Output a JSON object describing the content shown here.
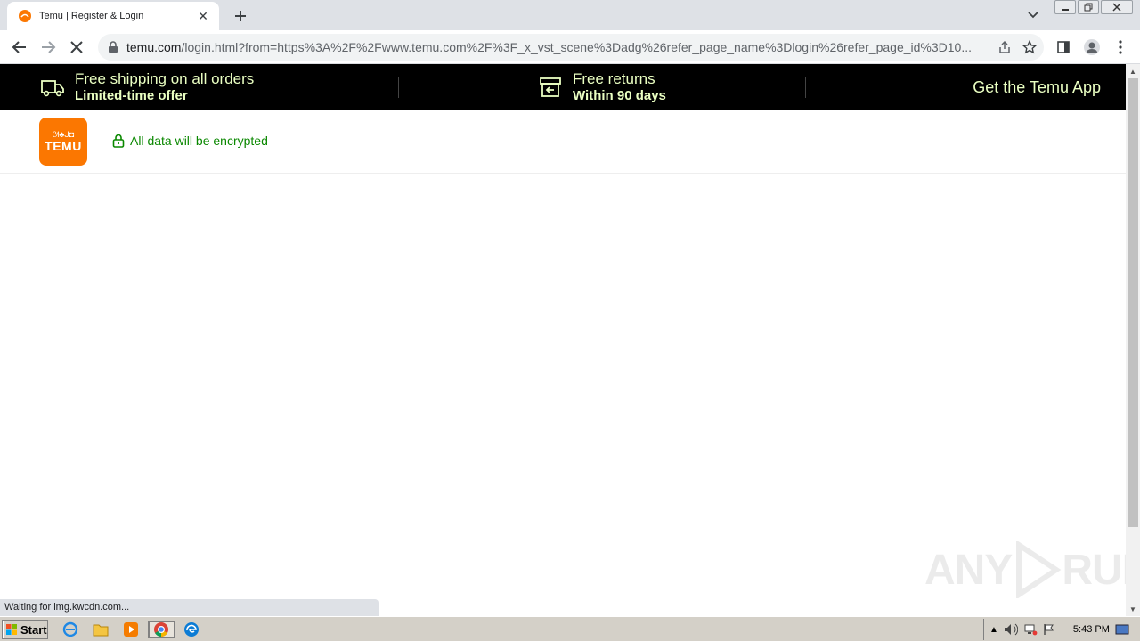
{
  "browser": {
    "tab_title": "Temu | Register & Login",
    "url_host": "temu.com",
    "url_path": "/login.html?from=https%3A%2F%2Fwww.temu.com%2F%3F_x_vst_scene%3Dadg%26refer_page_name%3Dlogin%26refer_page_id%3D10..."
  },
  "banner": {
    "shipping_title": "Free shipping on all orders",
    "shipping_sub": "Limited-time offer",
    "returns_title": "Free returns",
    "returns_sub": "Within 90 days",
    "app_link": "Get the Temu App"
  },
  "header": {
    "logo_text": "TEMU",
    "logo_symbols": "ᘛ♣ᒍ◘",
    "secure_text": "All data will be encrypted"
  },
  "status": {
    "loading_text": "Waiting for img.kwcdn.com..."
  },
  "watermark": {
    "left": "ANY",
    "right": "RUN"
  },
  "taskbar": {
    "start_label": "Start",
    "clock": "5:43 PM"
  },
  "colors": {
    "brand_orange": "#fb7701",
    "banner_bg": "#000000",
    "banner_text": "#eaffc2",
    "secure_green": "#0a8800"
  }
}
